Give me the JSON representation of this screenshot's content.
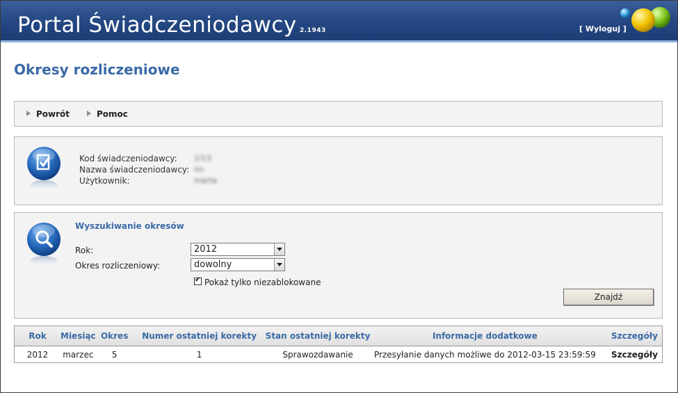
{
  "header": {
    "title": "Portal Świadczeniodawcy",
    "version": "2.1943",
    "logout_label": "[ Wyloguj ]"
  },
  "page_title": "Okresy rozliczeniowe",
  "nav": {
    "back_label": "Powrót",
    "help_label": "Pomoc"
  },
  "info": {
    "provider_code_label": "Kod świadczeniodawcy:",
    "provider_code_value": "1/13",
    "provider_name_label": "Nazwa świadczeniodawcy:",
    "provider_name_value": "nn",
    "user_label": "Użytkownik:",
    "user_value": "marta"
  },
  "search": {
    "title": "Wyszukiwanie okresów",
    "year_label": "Rok:",
    "year_value": "2012",
    "period_label": "Okres rozliczeniowy:",
    "period_value": "dowolny",
    "only_unblocked_label": "Pokaż tylko niezablokowane",
    "only_unblocked_checked": true,
    "find_button": "Znajdź"
  },
  "table": {
    "columns": [
      "Rok",
      "Miesiąc",
      "Okres",
      "Numer ostatniej korekty",
      "Stan ostatniej korekty",
      "Informacje dodatkowe",
      "Szczegóły"
    ],
    "rows": [
      {
        "year": "2012",
        "month": "marzec",
        "period": "5",
        "correction_number": "1",
        "correction_state": "Sprawozdawanie",
        "additional_info": "Przesyłanie danych możliwe do 2012-03-15 23:59:59",
        "details": "Szczegóły"
      }
    ]
  }
}
